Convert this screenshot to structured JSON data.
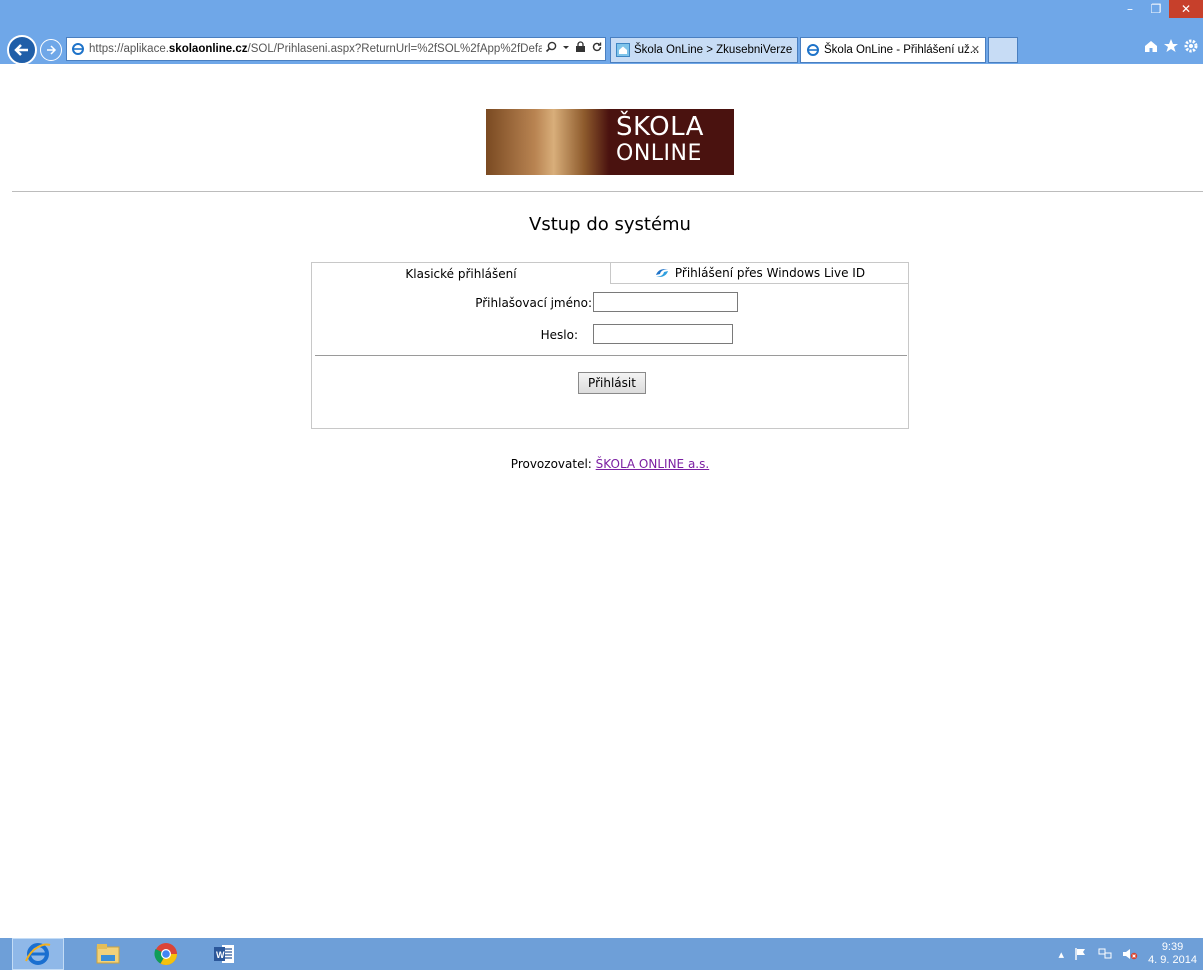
{
  "browser": {
    "address_prefix": "https://aplikace.",
    "address_host": "skolaonline.cz",
    "address_rest": "/SOL/Prihlaseni.aspx?ReturnUrl=%2fSOL%2fApp%2fDefaul",
    "tabs": [
      {
        "label": "Škola OnLine > ZkusebniVerze"
      },
      {
        "label": "Škola OnLine - Přihlášení už..."
      }
    ],
    "window_controls": {
      "minimize": "–",
      "restore": "❐",
      "close": "✕"
    }
  },
  "logo": {
    "line1": "ŠKOLA",
    "line2": "ONLINE"
  },
  "page": {
    "title": "Vstup do systému",
    "tabs": {
      "classic": "Klasické přihlášení",
      "live": "Přihlášení přes Windows Live ID"
    },
    "username_label": "Přihlašovací jméno:",
    "username_value": "",
    "password_label": "Heslo:",
    "password_value": "",
    "login_button": "Přihlásit",
    "operator_label": "Provozovatel:",
    "operator_link": "ŠKOLA ONLINE a.s."
  },
  "taskbar": {
    "clock_time": "9:39",
    "clock_date": "4. 9. 2014"
  },
  "colors": {
    "chrome": "#6fa7e8",
    "logo_bg": "#4a120f",
    "link": "#7b1fa2",
    "taskbar": "#6e9fd8"
  }
}
